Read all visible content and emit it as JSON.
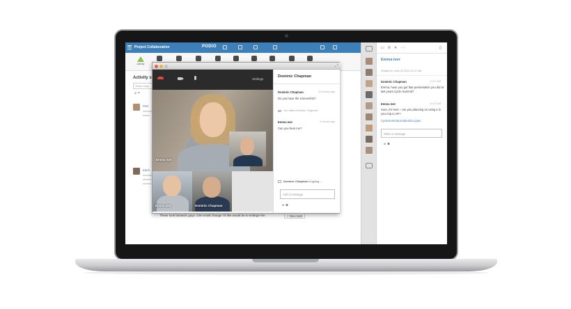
{
  "podio": {
    "workspace_title": "Project Collaboration",
    "logo": "PODIO",
    "nav_activity_label": "Activity",
    "stream_title": "Activity str",
    "share_placeholder": "Share inspi",
    "feed_names": [
      "Patr",
      "Zach"
    ],
    "bottom_comment": "These look fantastic guys. One small change I'd like would be to enlarge the",
    "new_task_label": "+ New task"
  },
  "call": {
    "settings_label": "Settings",
    "participants": {
      "main": "Emma Iver",
      "tile_left": "Emma Iver",
      "tile_right": "Dominic Chapman"
    },
    "chat": {
      "header": "Dominic Chapman",
      "messages": [
        {
          "from": "Dominic Chapman",
          "time": "5 minutes ago",
          "text": "Do you have the screenshot?"
        },
        {
          "from": "Emma Iver",
          "time": "1 minute ago",
          "text": "Can you hear me?"
        }
      ],
      "system_message": "You called Dominic Chapman",
      "typing_name": "Dominic Chapman",
      "typing_suffix": "is typing...",
      "input_placeholder": "Add a message"
    }
  },
  "chat_panel": {
    "contact_name": "Emma Iver",
    "started": "Started on June 20 2013 11:27 AM",
    "messages": [
      {
        "from": "Dominic Chapman",
        "time": "11:27 AM",
        "text": "Emma, have you got that presentation you did at last years Cycle Summit?"
      },
      {
        "from": "Emma Iver",
        "time": "11:31 AM",
        "text": "Sure, it's here – are you planning on using it in your trip to SF?"
      }
    ],
    "attachment": "CycleSummitLondon2012.pptx",
    "input_placeholder": "Write a message"
  },
  "colors": {
    "podio_blue": "#3d7fb8",
    "hangup_red": "#e24b3b",
    "activity_green": "#8cc04b"
  },
  "icons": [
    "menu-icon",
    "hangup-icon",
    "video-camera-icon",
    "microphone-icon",
    "expand-icon",
    "paperclip-icon",
    "emoji-icon",
    "keyboard-icon",
    "phone-icon",
    "close-icon"
  ]
}
